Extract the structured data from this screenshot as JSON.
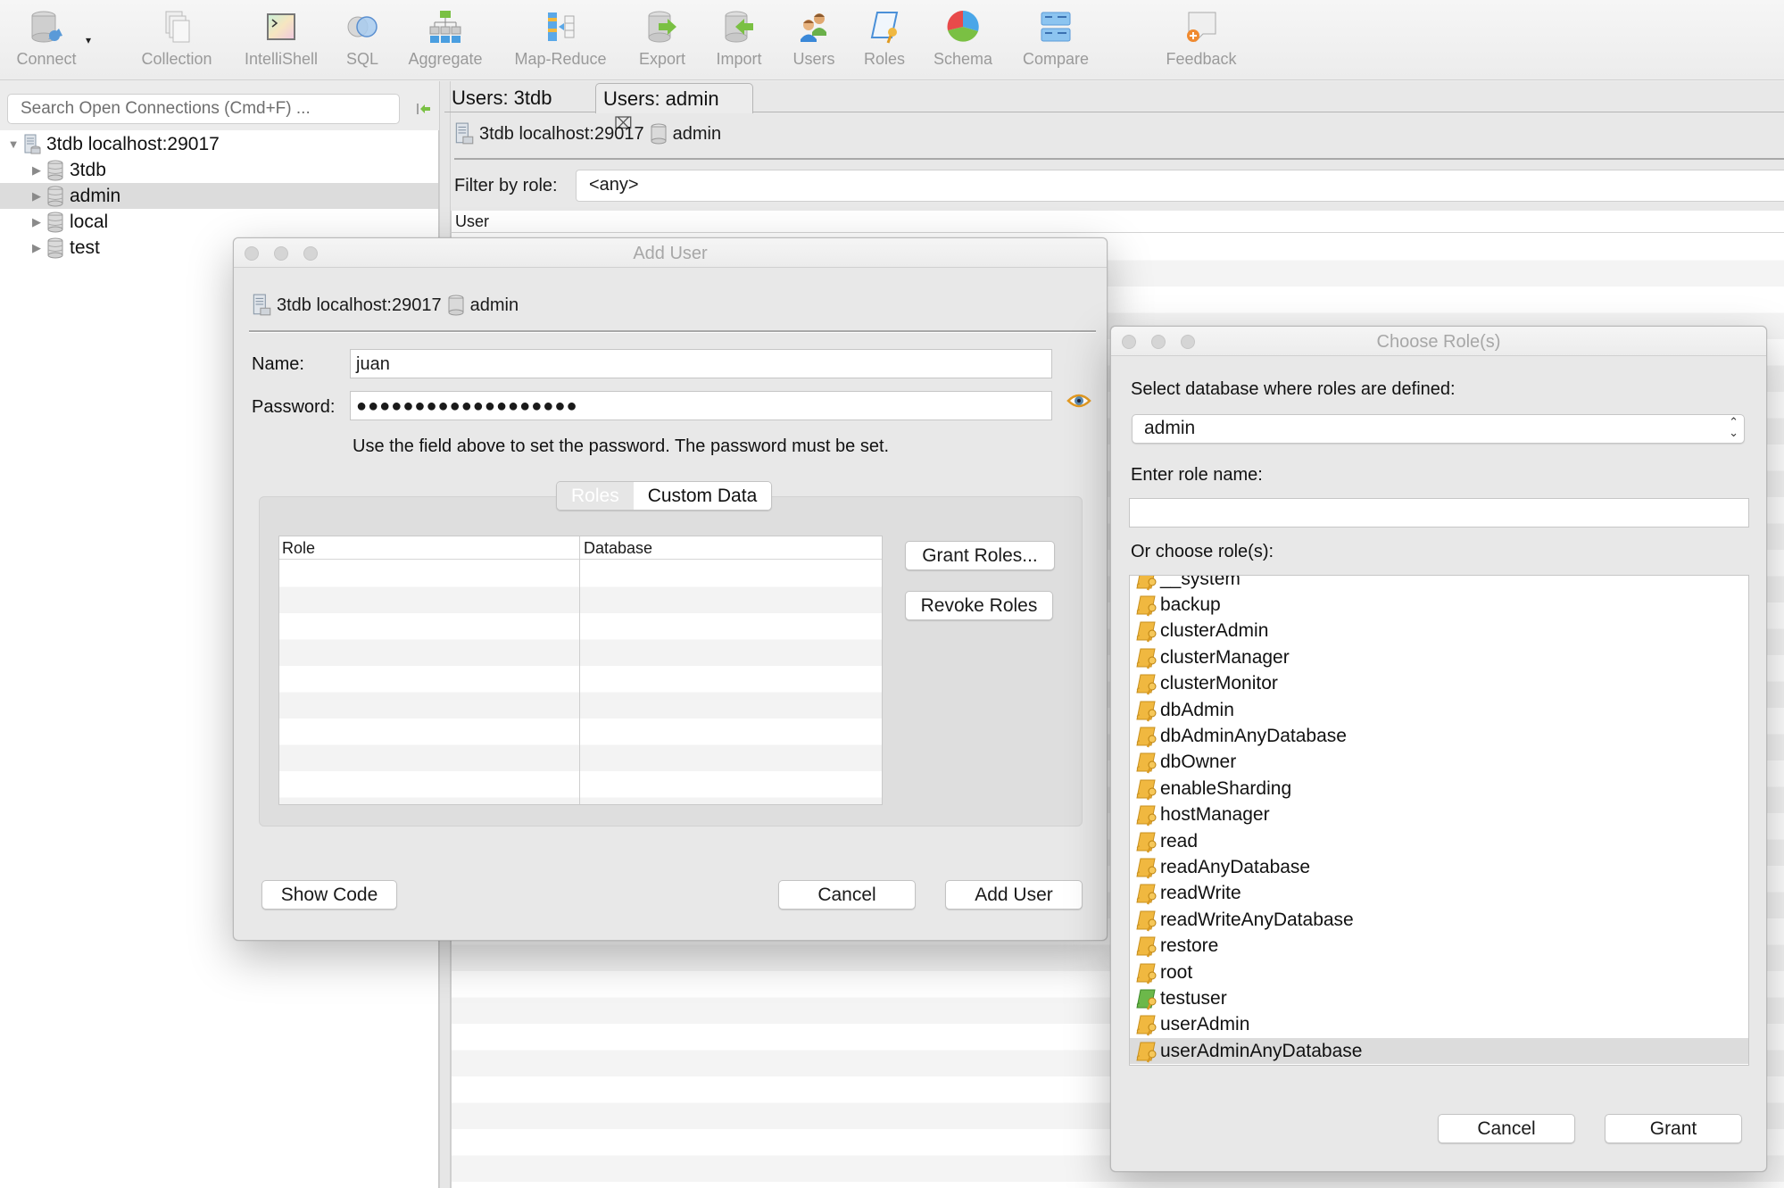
{
  "toolbar": {
    "items": [
      {
        "label": "Connect",
        "icon": "connect-icon"
      },
      {
        "label": "Collection",
        "icon": "collection-icon"
      },
      {
        "label": "IntelliShell",
        "icon": "intellishell-icon"
      },
      {
        "label": "SQL",
        "icon": "sql-icon"
      },
      {
        "label": "Aggregate",
        "icon": "aggregate-icon"
      },
      {
        "label": "Map-Reduce",
        "icon": "map-reduce-icon"
      },
      {
        "label": "Export",
        "icon": "export-icon"
      },
      {
        "label": "Import",
        "icon": "import-icon"
      },
      {
        "label": "Users",
        "icon": "users-icon"
      },
      {
        "label": "Roles",
        "icon": "roles-icon"
      },
      {
        "label": "Schema",
        "icon": "schema-icon"
      },
      {
        "label": "Compare",
        "icon": "compare-icon"
      },
      {
        "label": "Feedback",
        "icon": "feedback-icon"
      }
    ],
    "connect_caret": "▾"
  },
  "sidebar": {
    "search_placeholder": "Search Open Connections (Cmd+F) ...",
    "tree": {
      "connection": "3tdb localhost:29017",
      "databases": [
        {
          "name": "3tdb",
          "selected": false
        },
        {
          "name": "admin",
          "selected": true
        },
        {
          "name": "local",
          "selected": false
        },
        {
          "name": "test",
          "selected": false
        }
      ]
    }
  },
  "main": {
    "tabs": [
      {
        "label": "Users: 3tdb",
        "active": false
      },
      {
        "label": "Users: admin",
        "active": true,
        "close_icon": "⌧"
      }
    ],
    "breadcrumb": {
      "connection": "3tdb localhost:29017",
      "database": "admin"
    },
    "filter_label": "Filter by role:",
    "filter_value": "<any>",
    "table_header": "User"
  },
  "add_user_dialog": {
    "title": "Add User",
    "breadcrumb": {
      "connection": "3tdb localhost:29017",
      "database": "admin"
    },
    "name_label": "Name:",
    "name_value": "juan",
    "password_label": "Password:",
    "password_masked": "●●●●●●●●●●●●●●●●●●●",
    "password_hint": "Use the field above to set the password. The password must be set.",
    "tabs": [
      {
        "label": "Roles",
        "selected": true
      },
      {
        "label": "Custom Data",
        "selected": false
      }
    ],
    "roles_table": {
      "columns": [
        "Role",
        "Database"
      ],
      "rows": []
    },
    "grant_roles_button": "Grant Roles...",
    "revoke_roles_button": "Revoke Roles",
    "show_code_button": "Show Code",
    "cancel_button": "Cancel",
    "add_user_button": "Add User"
  },
  "choose_roles_dialog": {
    "title": "Choose Role(s)",
    "db_label": "Select database where roles are defined:",
    "db_value": "admin",
    "role_name_label": "Enter role name:",
    "role_name_value": "",
    "choose_label": "Or choose role(s):",
    "roles": [
      {
        "name": "__system",
        "type": "builtin",
        "selected": false
      },
      {
        "name": "backup",
        "type": "builtin",
        "selected": false
      },
      {
        "name": "clusterAdmin",
        "type": "builtin",
        "selected": false
      },
      {
        "name": "clusterManager",
        "type": "builtin",
        "selected": false
      },
      {
        "name": "clusterMonitor",
        "type": "builtin",
        "selected": false
      },
      {
        "name": "dbAdmin",
        "type": "builtin",
        "selected": false
      },
      {
        "name": "dbAdminAnyDatabase",
        "type": "builtin",
        "selected": false
      },
      {
        "name": "dbOwner",
        "type": "builtin",
        "selected": false
      },
      {
        "name": "enableSharding",
        "type": "builtin",
        "selected": false
      },
      {
        "name": "hostManager",
        "type": "builtin",
        "selected": false
      },
      {
        "name": "read",
        "type": "builtin",
        "selected": false
      },
      {
        "name": "readAnyDatabase",
        "type": "builtin",
        "selected": false
      },
      {
        "name": "readWrite",
        "type": "builtin",
        "selected": false
      },
      {
        "name": "readWriteAnyDatabase",
        "type": "builtin",
        "selected": false
      },
      {
        "name": "restore",
        "type": "builtin",
        "selected": false
      },
      {
        "name": "root",
        "type": "builtin",
        "selected": false
      },
      {
        "name": "testuser",
        "type": "custom",
        "selected": false
      },
      {
        "name": "userAdmin",
        "type": "builtin",
        "selected": false
      },
      {
        "name": "userAdminAnyDatabase",
        "type": "builtin",
        "selected": true
      }
    ],
    "cancel_button": "Cancel",
    "grant_button": "Grant"
  },
  "colors": {
    "builtin_role_icon": "#f0b840",
    "custom_role_icon": "#6cb84a",
    "selection_bg": "#dcdcdc"
  }
}
